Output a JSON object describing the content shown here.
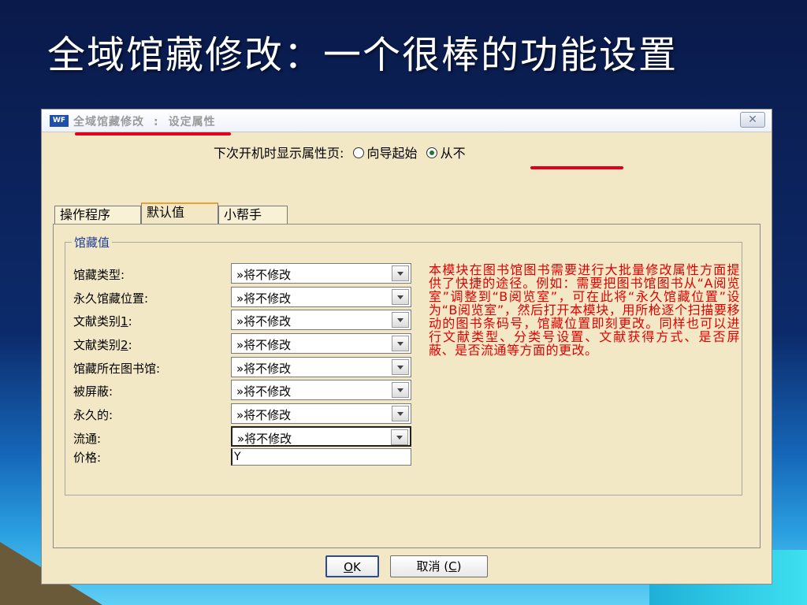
{
  "slide": {
    "title": "全域馆藏修改：一个很棒的功能设置"
  },
  "window": {
    "icon_label": "WF",
    "title_main": "全域馆藏修改",
    "title_sep": ":",
    "title_sub": "设定属性",
    "close_glyph": "✕"
  },
  "startup": {
    "label": "下次开机时显示属性页:",
    "options": [
      {
        "label": "向导起始",
        "selected": false
      },
      {
        "label": "从不",
        "selected": true
      }
    ]
  },
  "tabs": [
    {
      "label": "操作程序",
      "active": false
    },
    {
      "label": "默认值",
      "active": true
    },
    {
      "label": "小帮手",
      "active": false
    }
  ],
  "group": {
    "legend": "馆藏值",
    "fields": [
      {
        "label": "馆藏类型:",
        "value": "»将不修改"
      },
      {
        "label": "永久馆藏位置:",
        "value": "»将不修改"
      },
      {
        "label_prefix": "文献类别",
        "label_mn": "1",
        "label_suffix": ":",
        "value": "»将不修改"
      },
      {
        "label_prefix": "文献类别",
        "label_mn": "2",
        "label_suffix": ":",
        "value": "»将不修改"
      },
      {
        "label": "馆藏所在图书馆:",
        "value": "»将不修改"
      },
      {
        "label": "被屏蔽:",
        "value": "»将不修改"
      },
      {
        "label": "永久的:",
        "value": "»将不修改"
      },
      {
        "label": "流通:",
        "value": "»将不修改"
      }
    ],
    "price": {
      "label": "价格:",
      "value": "Y"
    }
  },
  "help_text": "本模块在图书馆图书需要进行大批量修改属性方面提供了快捷的途径。例如：需要把图书馆图书从“A阅览室”调整到“B阅览室”，可在此将“永久馆藏位置”设为“B阅览室”，然后打开本模块，用所枪逐个扫描要移动的图书条码号，馆藏位置即刻更改。同样也可以进行文献类型、分类号设置、文献获得方式、是否屏蔽、是否流通等方面的更改。",
  "buttons": {
    "ok_mn": "O",
    "ok_rest": "K",
    "cancel_prefix": "取消 (",
    "cancel_mn": "C",
    "cancel_suffix": ")"
  },
  "colors": {
    "annotation_red": "#e0001b",
    "legend_blue": "#1f3f9a",
    "help_red": "#e00000",
    "dialog_bg": "#f3e8c6"
  }
}
